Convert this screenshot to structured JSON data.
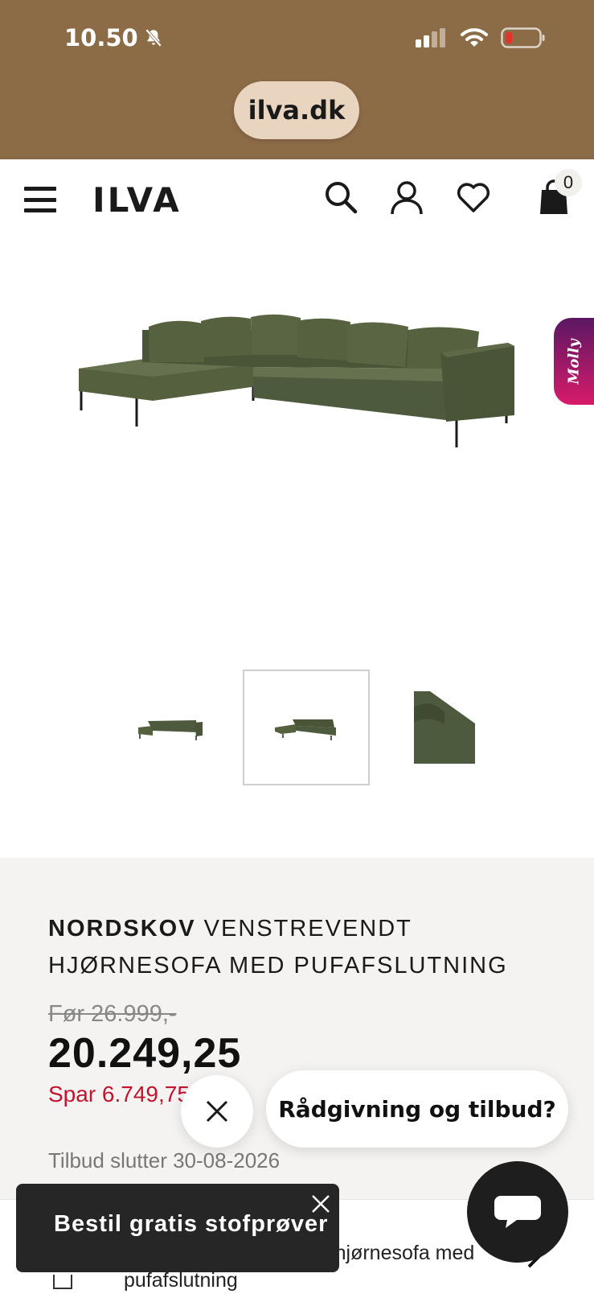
{
  "status": {
    "time": "10.50",
    "url": "ilva.dk"
  },
  "header": {
    "logo": "ILVA",
    "cart_count": "0"
  },
  "side_tab": {
    "label": "Molly"
  },
  "gallery": {
    "thumbnails": 3,
    "active_index": 1
  },
  "product": {
    "brand": "NORDSKOV",
    "title_rest": " VENSTREVENDT HJØRNESOFA MED PUFAFSLUTNING",
    "old_price": "Før 26.999,-",
    "price": "20.249,25",
    "savings": "Spar 6.749,75",
    "offer_ends": "Tilbud slutter 30-08-2026"
  },
  "chat": {
    "bubble_text": "Rådgivning og tilbud?"
  },
  "bottom_bar": {
    "text": "Nordskov venstrevendt hjørnesofa med pufafslutning"
  },
  "toast": {
    "label": "Bestil gratis stofprøver"
  },
  "colors": {
    "status_bg": "#8c6b47",
    "url_pill": "#e9d5bf",
    "sofa": "#4e5a3e",
    "save_red": "#c0152f",
    "panel_bg": "#f4f3f1"
  }
}
